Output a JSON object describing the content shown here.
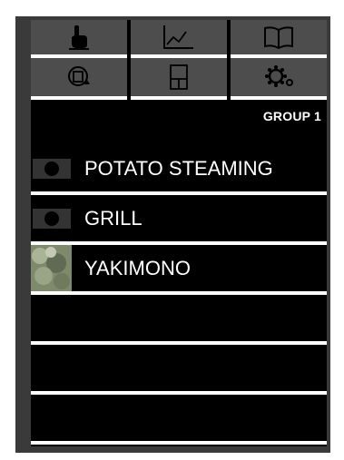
{
  "tabs_row1": [
    {
      "name": "touch-hand-icon"
    },
    {
      "name": "graph-icon"
    },
    {
      "name": "book-icon"
    }
  ],
  "tabs_row2": [
    {
      "name": "rotate-icon"
    },
    {
      "name": "layout-icon"
    },
    {
      "name": "settings-icon"
    }
  ],
  "group_label": "GROUP 1",
  "recipes": [
    {
      "label": "POTATO STEAMING",
      "thumb": "camera-icon"
    },
    {
      "label": "GRILL",
      "thumb": "camera-icon"
    },
    {
      "label": "YAKIMONO",
      "thumb": "photo-thumbnail"
    },
    {
      "label": ""
    },
    {
      "label": ""
    },
    {
      "label": ""
    }
  ],
  "colors": {
    "background": "#000000",
    "tab": "#4d4d4d",
    "frame": "#3a3a3a",
    "divider": "#ffffff"
  }
}
